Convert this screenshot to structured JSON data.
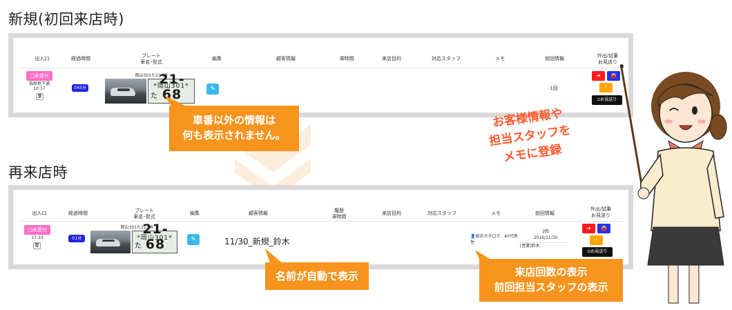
{
  "sections": {
    "new_title": "新規(初回来店時)",
    "revisit_title": "再来店時"
  },
  "headers_new": {
    "entrance": "出入口",
    "elapsed": "経過時間",
    "plate_l1": "プレート",
    "plate_l2": "車名･型式",
    "edit": "編集",
    "customer": "顧客情報",
    "stay": "滞時間",
    "purpose": "来店目的",
    "staff": "対応スタッフ",
    "memo": "メモ",
    "history": "前回情報",
    "exit_l1": "外出/試乗",
    "exit_l2": "お見送り"
  },
  "headers_revisit": {
    "entrance": "出入口",
    "elapsed": "経過時間",
    "plate_l1": "プレート",
    "plate_l2": "車名･型式",
    "edit": "編集",
    "customer": "顧客情報",
    "stay_l1": "履歴",
    "stay_l2": "滞時間",
    "purpose": "来店目的",
    "staff": "対応スタッフ",
    "memo": "メモ",
    "history": "前回情報",
    "exit_l1": "外出/試乗",
    "exit_l2": "お見送り"
  },
  "row_new": {
    "status": "□未受付",
    "location": "為郎地下通",
    "time": "10:37",
    "timer": "⏱45分",
    "plate_text": "岡山301た21-68",
    "plate_line1": "*岡山301*",
    "plate_hira": "た",
    "plate_num": "21-68",
    "history_count": "1回",
    "send_off": "⏻お見送り"
  },
  "row_revisit": {
    "status": "□未受付",
    "time": "17:33",
    "timer": "⏱1分",
    "plate_text": "岡山301た21-68",
    "plate_line1": "*岡山301*",
    "plate_hira": "た",
    "plate_num": "21-68",
    "customer_name": "11/30_新規_鈴木",
    "memo": "総合カタログ、40代男性",
    "history_count": "2回",
    "history_date": "2016/11/30",
    "history_staff": "[営業]鈴木",
    "send_off": "⏻お見送り"
  },
  "callouts": {
    "no_info_l1": "車番以外の情報は",
    "no_info_l2": "何も表示されません。",
    "auto_name": "名前が自動で表示",
    "visits_l1": "来店回数の表示",
    "visits_l2": "前回担当スタッフの表示",
    "note_l1": "お客様情報や",
    "note_l2": "担当スタッフを",
    "note_l3": "メモに登録"
  },
  "colors": {
    "callout": "#f7941d",
    "pink_badge": "#ff6ec7",
    "timer_blue": "#2222dd",
    "edit_cyan": "#3ab7ea",
    "note_text": "#ff5a2c"
  }
}
